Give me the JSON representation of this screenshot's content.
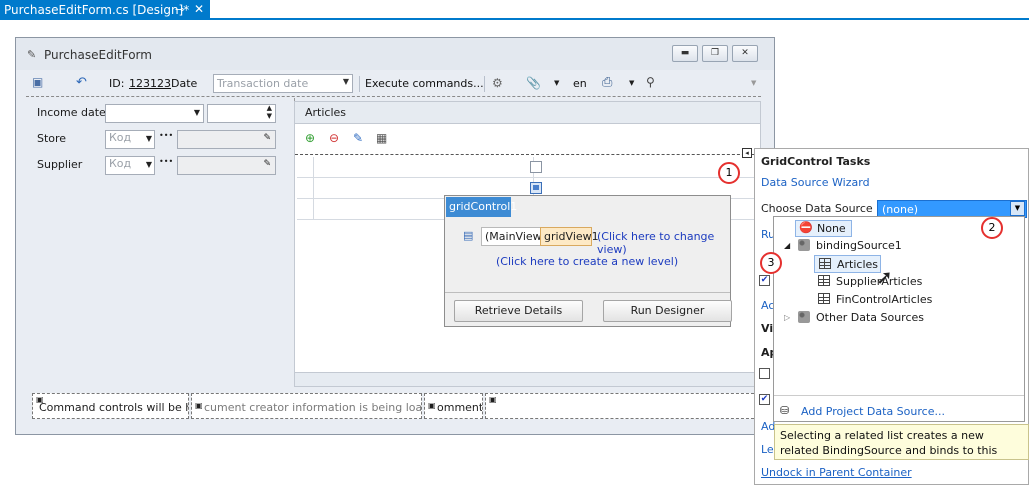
{
  "ide": {
    "doc_tab": "PurchaseEditForm.cs [Design]*",
    "pin_icon": "pin-icon",
    "close_icon": "close-icon"
  },
  "form": {
    "title": "PurchaseEditForm",
    "window_buttons": [
      "minimize-icon",
      "restore-icon",
      "close-icon"
    ]
  },
  "toolbar": {
    "id_label": "ID:",
    "id_value": "123123",
    "date_label": "Date",
    "date_placeholder": "Transaction date",
    "execute": "Execute commands...",
    "lang": "en"
  },
  "left": {
    "income_date": "Income date",
    "store": "Store",
    "supplier": "Supplier",
    "code_placeholder": "Код",
    "ellipsis": "•••"
  },
  "articles": {
    "header": "Articles"
  },
  "gridpopup": {
    "name": "gridControl1",
    "main_view": "(MainView)",
    "grid_view": "gridView1",
    "change_view": "(Click here to change view)",
    "new_level": "(Click here to create a new level)",
    "retrieve": "Retrieve Details",
    "designer": "Run Designer"
  },
  "bottom": {
    "commands": "Command controls will be here.",
    "creator": "cument creator information is being loaded...",
    "comments": "omments:"
  },
  "tasks": {
    "title": "GridControl Tasks",
    "wizard": "Data Source Wizard",
    "choose": "Choose Data Source",
    "current": "(none)",
    "cut_ru": "Ru",
    "cut_ac": "Ac",
    "cut_vi": "Vi",
    "cut_ap": "Ap",
    "cut_ad": "Ad",
    "cut_le": "Le",
    "undock": "Undock in Parent Container"
  },
  "tree": {
    "none": "None",
    "binding": "bindingSource1",
    "articles": "Articles",
    "supplier": "SupplierArticles",
    "fincontrol": "FinControlArticles",
    "other": "Other Data Sources",
    "add": "Add Project Data Source..."
  },
  "hint": "Selecting a related list creates a new related BindingSource and binds to this BindingSo...",
  "callouts": [
    "1",
    "2",
    "3"
  ],
  "colors": {
    "vs_accent": "#007acc",
    "selection": "#3399ff",
    "callout": "#e5302e",
    "link": "#1c62c4"
  }
}
